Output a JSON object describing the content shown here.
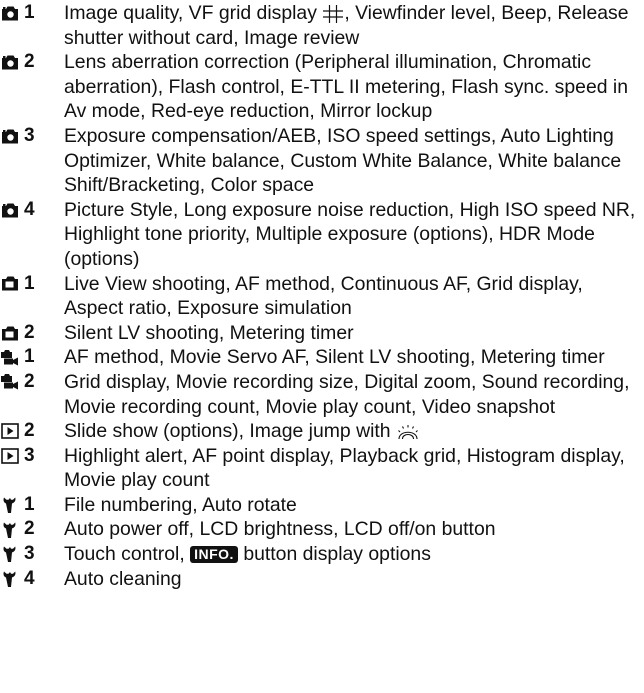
{
  "entries": [
    {
      "icon": "camera-icon",
      "num": "1",
      "parts": [
        "Image quality, VF grid display ",
        "{grid}",
        ", Viewfinder level, Beep, Release shutter without card, Image review"
      ]
    },
    {
      "icon": "camera-icon",
      "num": "2",
      "parts": [
        "Lens aberration correction (Peripheral illumination, Chromatic aberration), Flash control, E-TTL II metering, Flash sync. speed in Av mode, Red-eye reduction, Mirror lockup"
      ]
    },
    {
      "icon": "camera-icon",
      "num": "3",
      "parts": [
        "Exposure compensation/AEB, ISO speed settings, Auto Lighting Optimizer, White balance, Custom White Balance, White balance Shift/Bracketing, Color space"
      ]
    },
    {
      "icon": "camera-icon",
      "num": "4",
      "parts": [
        "Picture Style, Long exposure noise reduction, High ISO speed NR, Highlight tone priority, Multiple exposure (options), HDR Mode (options)"
      ]
    },
    {
      "icon": "live-view-icon",
      "num": "1",
      "parts": [
        "Live View shooting, AF method, Continuous AF, Grid display, Aspect ratio, Exposure simulation"
      ]
    },
    {
      "icon": "live-view-icon",
      "num": "2",
      "parts": [
        "Silent LV shooting, Metering timer"
      ]
    },
    {
      "icon": "movie-icon",
      "num": "1",
      "parts": [
        "AF method, Movie Servo AF, Silent LV shooting, Metering timer"
      ]
    },
    {
      "icon": "movie-icon",
      "num": "2",
      "parts": [
        "Grid display, Movie recording size, Digital zoom, Sound recording, Movie recording count, Movie play count, Video snapshot"
      ]
    },
    {
      "icon": "playback-icon",
      "num": "2",
      "parts": [
        "Slide show (options), Image jump with ",
        "{dial}"
      ]
    },
    {
      "icon": "playback-icon",
      "num": "3",
      "parts": [
        "Highlight alert, AF point display, Playback grid, Histogram display, Movie play count"
      ]
    },
    {
      "icon": "wrench-icon",
      "num": "1",
      "parts": [
        "File numbering, Auto rotate"
      ]
    },
    {
      "icon": "wrench-icon",
      "num": "2",
      "parts": [
        "Auto power off, LCD brightness, LCD off/on button"
      ]
    },
    {
      "icon": "wrench-icon",
      "num": "3",
      "parts": [
        "Touch control, ",
        "{info}",
        " button display options"
      ]
    },
    {
      "icon": "wrench-icon",
      "num": "4",
      "parts": [
        "Auto cleaning"
      ]
    }
  ],
  "info_badge_text": "INFO.",
  "colors": {
    "text": "#111111",
    "background": "#ffffff"
  }
}
